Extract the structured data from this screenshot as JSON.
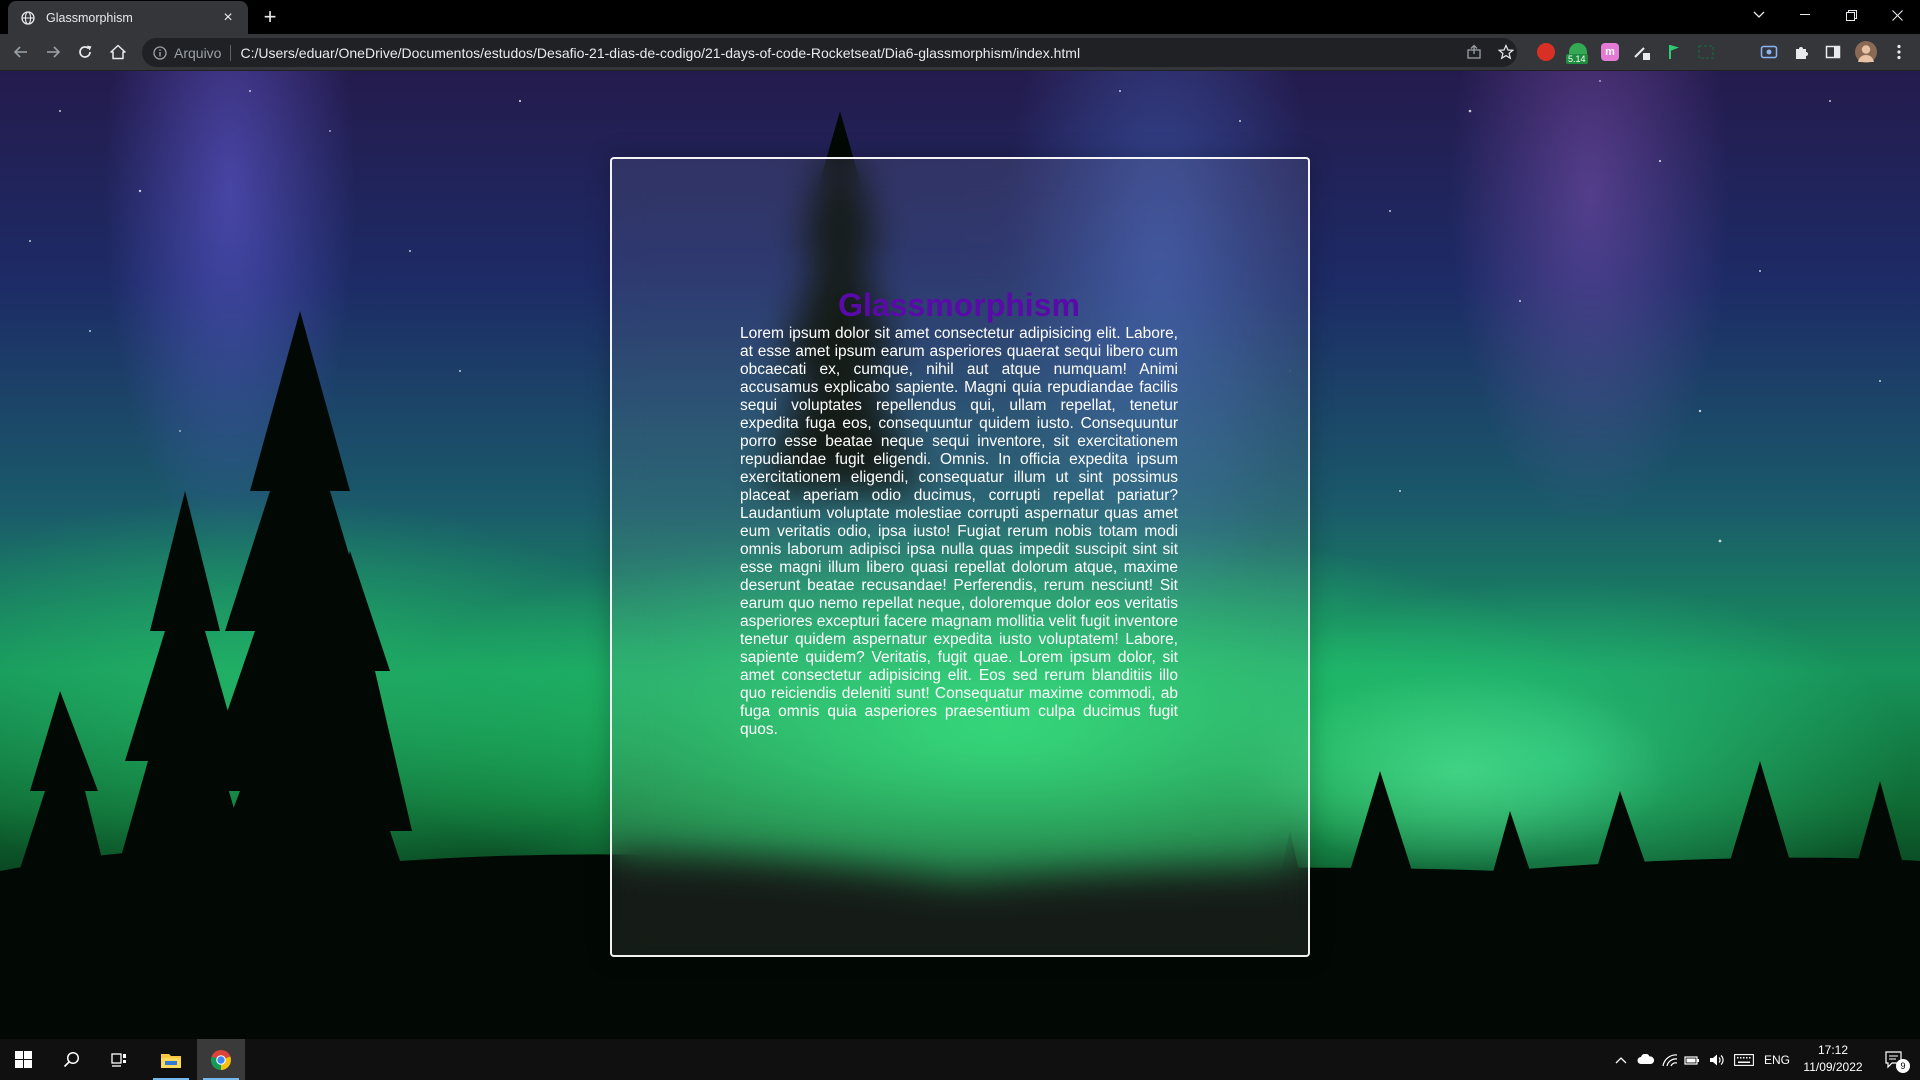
{
  "browser": {
    "tab_title": "Glassmorphism",
    "tab_close": "×",
    "new_tab": "+",
    "address_label": "Arquivo",
    "url": "C:/Users/eduar/OneDrive/Documentos/estudos/Desafio-21-dias-de-codigo/21-days-of-code-Rocketseat/Dia6-glassmorphism/index.html",
    "extension_badge": "5.14"
  },
  "page": {
    "title": "Glassmorphism",
    "body": "Lorem ipsum dolor sit amet consectetur adipisicing elit. Labore, at esse amet ipsum earum asperiores quaerat sequi libero cum obcaecati ex, cumque, nihil aut atque numquam! Animi accusamus explicabo sapiente. Magni quia repudiandae facilis sequi voluptates repellendus qui, ullam repellat, tenetur expedita fuga eos, consequuntur quidem iusto. Consequuntur porro esse beatae neque sequi inventore, sit exercitationem repudiandae fugit eligendi. Omnis. In officia expedita ipsum exercitationem eligendi, consequatur illum ut sint possimus placeat aperiam odio ducimus, corrupti repellat pariatur? Laudantium voluptate molestiae corrupti aspernatur quas amet eum veritatis odio, ipsa iusto! Fugiat rerum nobis totam modi omnis laborum adipisci ipsa nulla quas impedit suscipit sint sit esse magni illum libero quasi repellat dolorum atque, maxime deserunt beatae recusandae! Perferendis, rerum nesciunt! Sit earum quo nemo repellat neque, doloremque dolor eos veritatis asperiores excepturi facere magnam mollitia velit fugit inventore tenetur quidem aspernatur expedita iusto voluptatem! Labore, sapiente quidem? Veritatis, fugit quae. Lorem ipsum dolor, sit amet consectetur adipisicing elit. Eos sed rerum blanditiis illo quo reiciendis deleniti sunt! Consequatur maxime commodi, ab fuga omnis quia asperiores praesentium culpa ducimus fugit quos."
  },
  "taskbar": {
    "language": "ENG",
    "time": "17:12",
    "date": "11/09/2022",
    "notification_count": "9"
  },
  "colors": {
    "title_color": "#5a0aa8",
    "glass_border": "#ffffff",
    "chrome_bg": "#35363a"
  },
  "icons": [
    "globe-icon",
    "close-icon",
    "plus-icon",
    "chevron-down-icon",
    "minimize-icon",
    "restore-icon",
    "window-close-icon",
    "back-icon",
    "forward-icon",
    "reload-icon",
    "home-icon",
    "info-icon",
    "share-icon",
    "star-icon",
    "puzzle-icon",
    "sidepanel-icon",
    "profile-avatar",
    "menu-dots-icon",
    "windows-start-icon",
    "search-icon",
    "task-view-icon",
    "file-explorer-icon",
    "chrome-icon"
  ]
}
